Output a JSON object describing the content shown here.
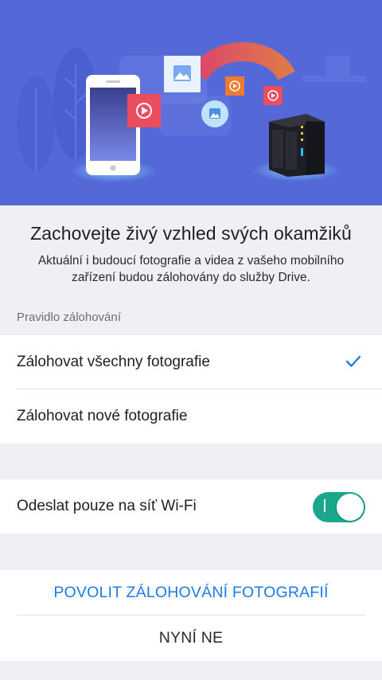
{
  "intro": {
    "title": "Zachovejte živý vzhled svých okamžiků",
    "description": "Aktuální i budoucí fotografie a videa z vašeho mobilního zařízení budou zálohovány do služby Drive."
  },
  "backup_rule": {
    "section_label": "Pravidlo zálohování",
    "options": [
      {
        "label": "Zálohovat všechny fotografie",
        "selected": true
      },
      {
        "label": "Zálohovat nové fotografie",
        "selected": false
      }
    ]
  },
  "wifi": {
    "label": "Odeslat pouze na síť Wi-Fi",
    "enabled": true
  },
  "actions": {
    "primary": "POVOLIT ZÁLOHOVÁNÍ FOTOGRAFIÍ",
    "secondary": "NYNÍ NE"
  },
  "colors": {
    "hero_background": "#5468d8",
    "accent_blue": "#1e7be6",
    "toggle_on": "#1aa88c"
  }
}
